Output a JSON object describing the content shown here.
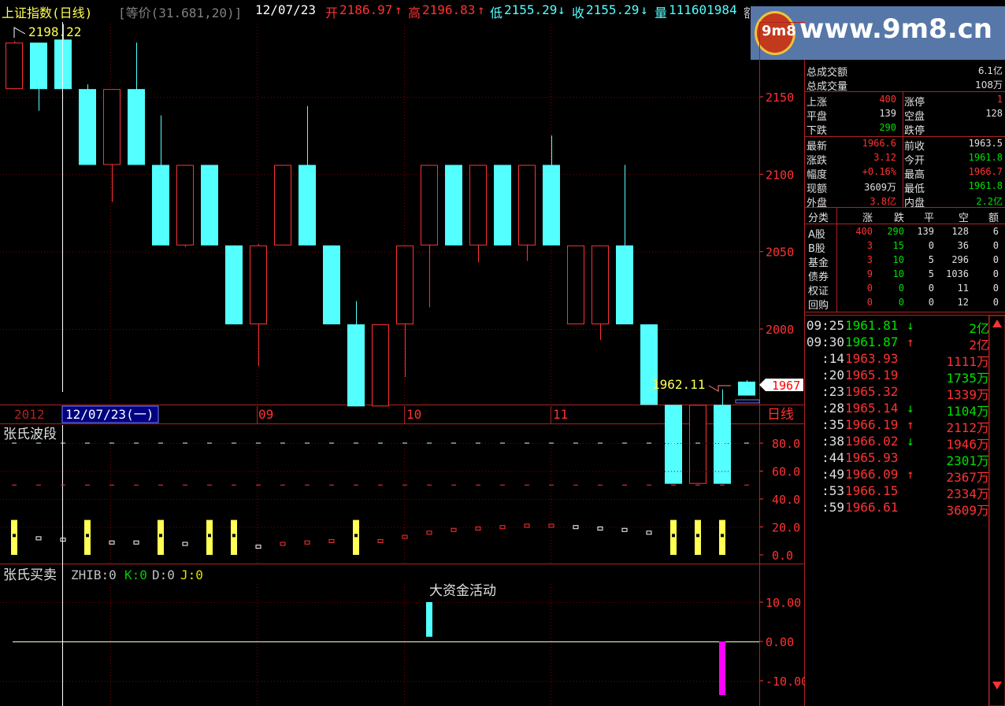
{
  "header": {
    "index_name": "上证指数",
    "period": "(日线)",
    "indicator": "[等价(31.681,20)]",
    "date": "12/07/23",
    "open_label": "开",
    "open_value": "2186.97",
    "high_label": "高",
    "high_value": "2196.83",
    "low_label": "低",
    "low_value": "2155.29",
    "close_label": "收",
    "close_value": "2155.29",
    "volume_label": "量",
    "volume_value": "111601984",
    "truncated": "额"
  },
  "watermark": {
    "logo_text": "9m8",
    "site": "www.9m8.cn"
  },
  "price_chart": {
    "high_marker": "2198.22",
    "low_marker": "1962.11",
    "current_price_tag": "1967",
    "y_ticks": [
      "2150",
      "2100",
      "2050",
      "2000"
    ],
    "date_axis": {
      "year": "2012",
      "cursor_date": "12/07/23(一)",
      "months": [
        "09",
        "10",
        "11"
      ],
      "period_label": "日线"
    }
  },
  "chart_data": [
    {
      "type": "candlestick",
      "title": "上证指数 (日线)",
      "ylim": [
        1960,
        2205
      ],
      "candles": [
        {
          "o": 2155,
          "h": 2186,
          "l": 2155,
          "c": 2185
        },
        {
          "o": 2185,
          "h": 2185,
          "l": 2141,
          "c": 2155
        },
        {
          "o": 2187,
          "h": 2197,
          "l": 2155,
          "c": 2155
        },
        {
          "o": 2155,
          "h": 2158,
          "l": 2106,
          "c": 2106
        },
        {
          "o": 2106,
          "h": 2155,
          "l": 2082,
          "c": 2155
        },
        {
          "o": 2155,
          "h": 2185,
          "l": 2106,
          "c": 2106
        },
        {
          "o": 2106,
          "h": 2138,
          "l": 2054,
          "c": 2054
        },
        {
          "o": 2054,
          "h": 2106,
          "l": 2053,
          "c": 2106
        },
        {
          "o": 2106,
          "h": 2106,
          "l": 2054,
          "c": 2054
        },
        {
          "o": 2054,
          "h": 2054,
          "l": 2003,
          "c": 2003
        },
        {
          "o": 2003,
          "h": 2055,
          "l": 1976,
          "c": 2054
        },
        {
          "o": 2054,
          "h": 2106,
          "l": 2054,
          "c": 2106
        },
        {
          "o": 2106,
          "h": 2144,
          "l": 2054,
          "c": 2054
        },
        {
          "o": 2054,
          "h": 2054,
          "l": 2003,
          "c": 2003
        },
        {
          "o": 2003,
          "h": 2018,
          "l": 1950,
          "c": 1950
        },
        {
          "o": 1950,
          "h": 2003,
          "l": 1953,
          "c": 2003
        },
        {
          "o": 2003,
          "h": 2054,
          "l": 1969,
          "c": 2054
        },
        {
          "o": 2054,
          "h": 2106,
          "l": 2014,
          "c": 2106
        },
        {
          "o": 2106,
          "h": 2106,
          "l": 2054,
          "c": 2054
        },
        {
          "o": 2054,
          "h": 2106,
          "l": 2043,
          "c": 2106
        },
        {
          "o": 2106,
          "h": 2106,
          "l": 2054,
          "c": 2054
        },
        {
          "o": 2054,
          "h": 2106,
          "l": 2044,
          "c": 2106
        },
        {
          "o": 2106,
          "h": 2125,
          "l": 2054,
          "c": 2054
        },
        {
          "o": 2003,
          "h": 2054,
          "l": 2003,
          "c": 2054
        },
        {
          "o": 2003,
          "h": 2054,
          "l": 1993,
          "c": 2054
        },
        {
          "o": 2054,
          "h": 2106,
          "l": 2003,
          "c": 2003
        },
        {
          "o": 2003,
          "h": 2003,
          "l": 1951,
          "c": 1951
        },
        {
          "o": 1951,
          "h": 1951,
          "l": 1900,
          "c": 1900
        },
        {
          "o": 1900,
          "h": 1951,
          "l": 1900,
          "c": 1951
        },
        {
          "o": 1951,
          "h": 1961,
          "l": 1900,
          "c": 1900
        },
        {
          "o": 1966,
          "h": 1967,
          "l": 1957,
          "c": 1957
        }
      ]
    },
    {
      "type": "bar",
      "title": "张氏波段",
      "ylim": [
        0,
        90
      ],
      "y_ticks": [
        "80.0",
        "60.0",
        "40.0",
        "20.0",
        "0.0"
      ]
    },
    {
      "type": "bar",
      "title": "张氏买卖",
      "legend": [
        {
          "label": "ZHIB:0",
          "color": "#c0c0c0"
        },
        {
          "label": "K:0",
          "color": "#00cc00"
        },
        {
          "label": "D:0",
          "color": "#c0c0c0"
        },
        {
          "label": "J:0",
          "color": "#e0e000"
        }
      ],
      "annotation": "大资金活动",
      "ylim": [
        -15,
        15
      ],
      "y_ticks": [
        "10.00",
        "0.00",
        "-10.00"
      ]
    }
  ],
  "side_panel": {
    "summary": [
      {
        "label": "总成交额",
        "value": "6.1亿"
      },
      {
        "label": "总成交量",
        "value": "108万"
      }
    ],
    "breadth": [
      {
        "l1": "上涨",
        "v1": "400",
        "l2": "涨停",
        "v2": "1"
      },
      {
        "l1": "平盘",
        "v1": "139",
        "l2": "空盘",
        "v2": "128"
      },
      {
        "l1": "下跌",
        "v1": "290",
        "l2": "跌停",
        "v2": ""
      }
    ],
    "quote": [
      {
        "l1": "最新",
        "v1": "1966.6",
        "l2": "前收",
        "v2": "1963.5"
      },
      {
        "l1": "涨跌",
        "v1": "3.12",
        "l2": "今开",
        "v2": "1961.8"
      },
      {
        "l1": "幅度",
        "v1": "+0.16%",
        "l2": "最高",
        "v2": "1966.7"
      },
      {
        "l1": "现额",
        "v1": "3609万",
        "l2": "最低",
        "v2": "1961.8"
      },
      {
        "l1": "外盘",
        "v1": "3.8亿",
        "l2": "内盘",
        "v2": "2.2亿"
      }
    ],
    "category_headers": [
      "分类",
      "涨",
      "跌",
      "平",
      "空",
      "额"
    ],
    "categories": [
      {
        "name": "A股",
        "up": "400",
        "down": "290",
        "flat": "139",
        "empty": "128",
        "amount": "6"
      },
      {
        "name": "B股",
        "up": "3",
        "down": "15",
        "flat": "0",
        "empty": "36",
        "amount": "0"
      },
      {
        "name": "基金",
        "up": "3",
        "down": "10",
        "flat": "5",
        "empty": "296",
        "amount": "0"
      },
      {
        "name": "债券",
        "up": "9",
        "down": "10",
        "flat": "5",
        "empty": "1036",
        "amount": "0"
      },
      {
        "name": "权证",
        "up": "0",
        "down": "0",
        "flat": "0",
        "empty": "11",
        "amount": "0"
      },
      {
        "name": "回购",
        "up": "0",
        "down": "0",
        "flat": "0",
        "empty": "12",
        "amount": "0"
      }
    ],
    "ticks": [
      {
        "time": "09:25",
        "price": "1961.81",
        "arrow": "↓",
        "amount": "2亿"
      },
      {
        "time": "09:30",
        "price": "1961.87",
        "arrow": "↑",
        "amount": "2亿"
      },
      {
        "time": ":14",
        "price": "1963.93",
        "arrow": "",
        "amount": "1111万"
      },
      {
        "time": ":20",
        "price": "1965.19",
        "arrow": "",
        "amount": "1735万"
      },
      {
        "time": ":23",
        "price": "1965.32",
        "arrow": "",
        "amount": "1339万"
      },
      {
        "time": ":28",
        "price": "1965.14",
        "arrow": "↓",
        "amount": "1104万"
      },
      {
        "time": ":35",
        "price": "1966.19",
        "arrow": "↑",
        "amount": "2112万"
      },
      {
        "time": ":38",
        "price": "1966.02",
        "arrow": "↓",
        "amount": "1946万"
      },
      {
        "time": ":44",
        "price": "1965.93",
        "arrow": "",
        "amount": "2301万"
      },
      {
        "time": ":49",
        "price": "1966.09",
        "arrow": "↑",
        "amount": "2367万"
      },
      {
        "time": ":53",
        "price": "1966.15",
        "arrow": "",
        "amount": "2334万"
      },
      {
        "time": ":59",
        "price": "1966.61",
        "arrow": "",
        "amount": "3609万"
      }
    ]
  },
  "colors": {
    "up": "#ff3232",
    "down": "#54ffff",
    "grid": "#800000",
    "axis_text": "#ff3232",
    "yellow": "#ffff54"
  }
}
